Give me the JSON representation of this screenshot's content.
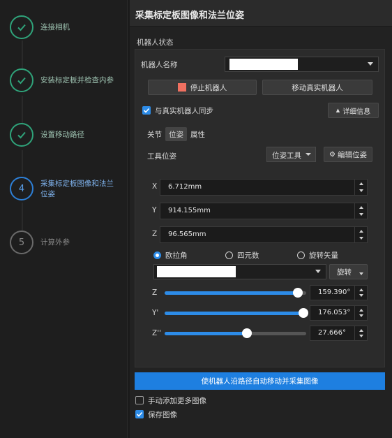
{
  "stepper": {
    "steps": [
      {
        "label": "连接相机",
        "state": "done"
      },
      {
        "label": "安装标定板并检查内参",
        "state": "done"
      },
      {
        "label": "设置移动路径",
        "state": "done"
      },
      {
        "label_line1": "采集标定板图像和法兰",
        "label_line2": "位姿",
        "number": "4",
        "state": "active"
      },
      {
        "label": "计算外参",
        "number": "5",
        "state": "pending"
      }
    ]
  },
  "panel": {
    "title": "采集标定板图像和法兰位姿",
    "robot_status_label": "机器人状态",
    "robot_name_label": "机器人名称",
    "stop_robot_label": "停止机器人",
    "move_real_robot_label": "移动真实机器人",
    "sync_real_robot_label": "与真实机器人同步",
    "details_label": "详细信息",
    "tabs": [
      "关节",
      "位姿",
      "属性"
    ],
    "tool_pose_label": "工具位姿",
    "pose_tool_select": "位姿工具",
    "edit_pose_label": "编辑位姿",
    "xyz": [
      {
        "axis": "X",
        "value": "6.712mm"
      },
      {
        "axis": "Y",
        "value": "914.155mm"
      },
      {
        "axis": "Z",
        "value": "96.565mm"
      }
    ],
    "rotation_modes": [
      "欧拉角",
      "四元数",
      "旋转矢量"
    ],
    "rotate_label": "旋转",
    "angles": [
      {
        "axis": "Z",
        "value": "159.390°",
        "level": 0.94
      },
      {
        "axis": "Y'",
        "value": "176.053°",
        "level": 0.98
      },
      {
        "axis": "Z''",
        "value": "27.666°",
        "level": 0.58
      }
    ],
    "auto_move_button": "使机器人沿路径自动移动并采集图像",
    "manual_add_label": "手动添加更多图像",
    "save_images_label": "保存图像"
  },
  "colors": {
    "accent": "#2d8ce8",
    "done": "#2fa37a",
    "stop": "#f07060"
  }
}
